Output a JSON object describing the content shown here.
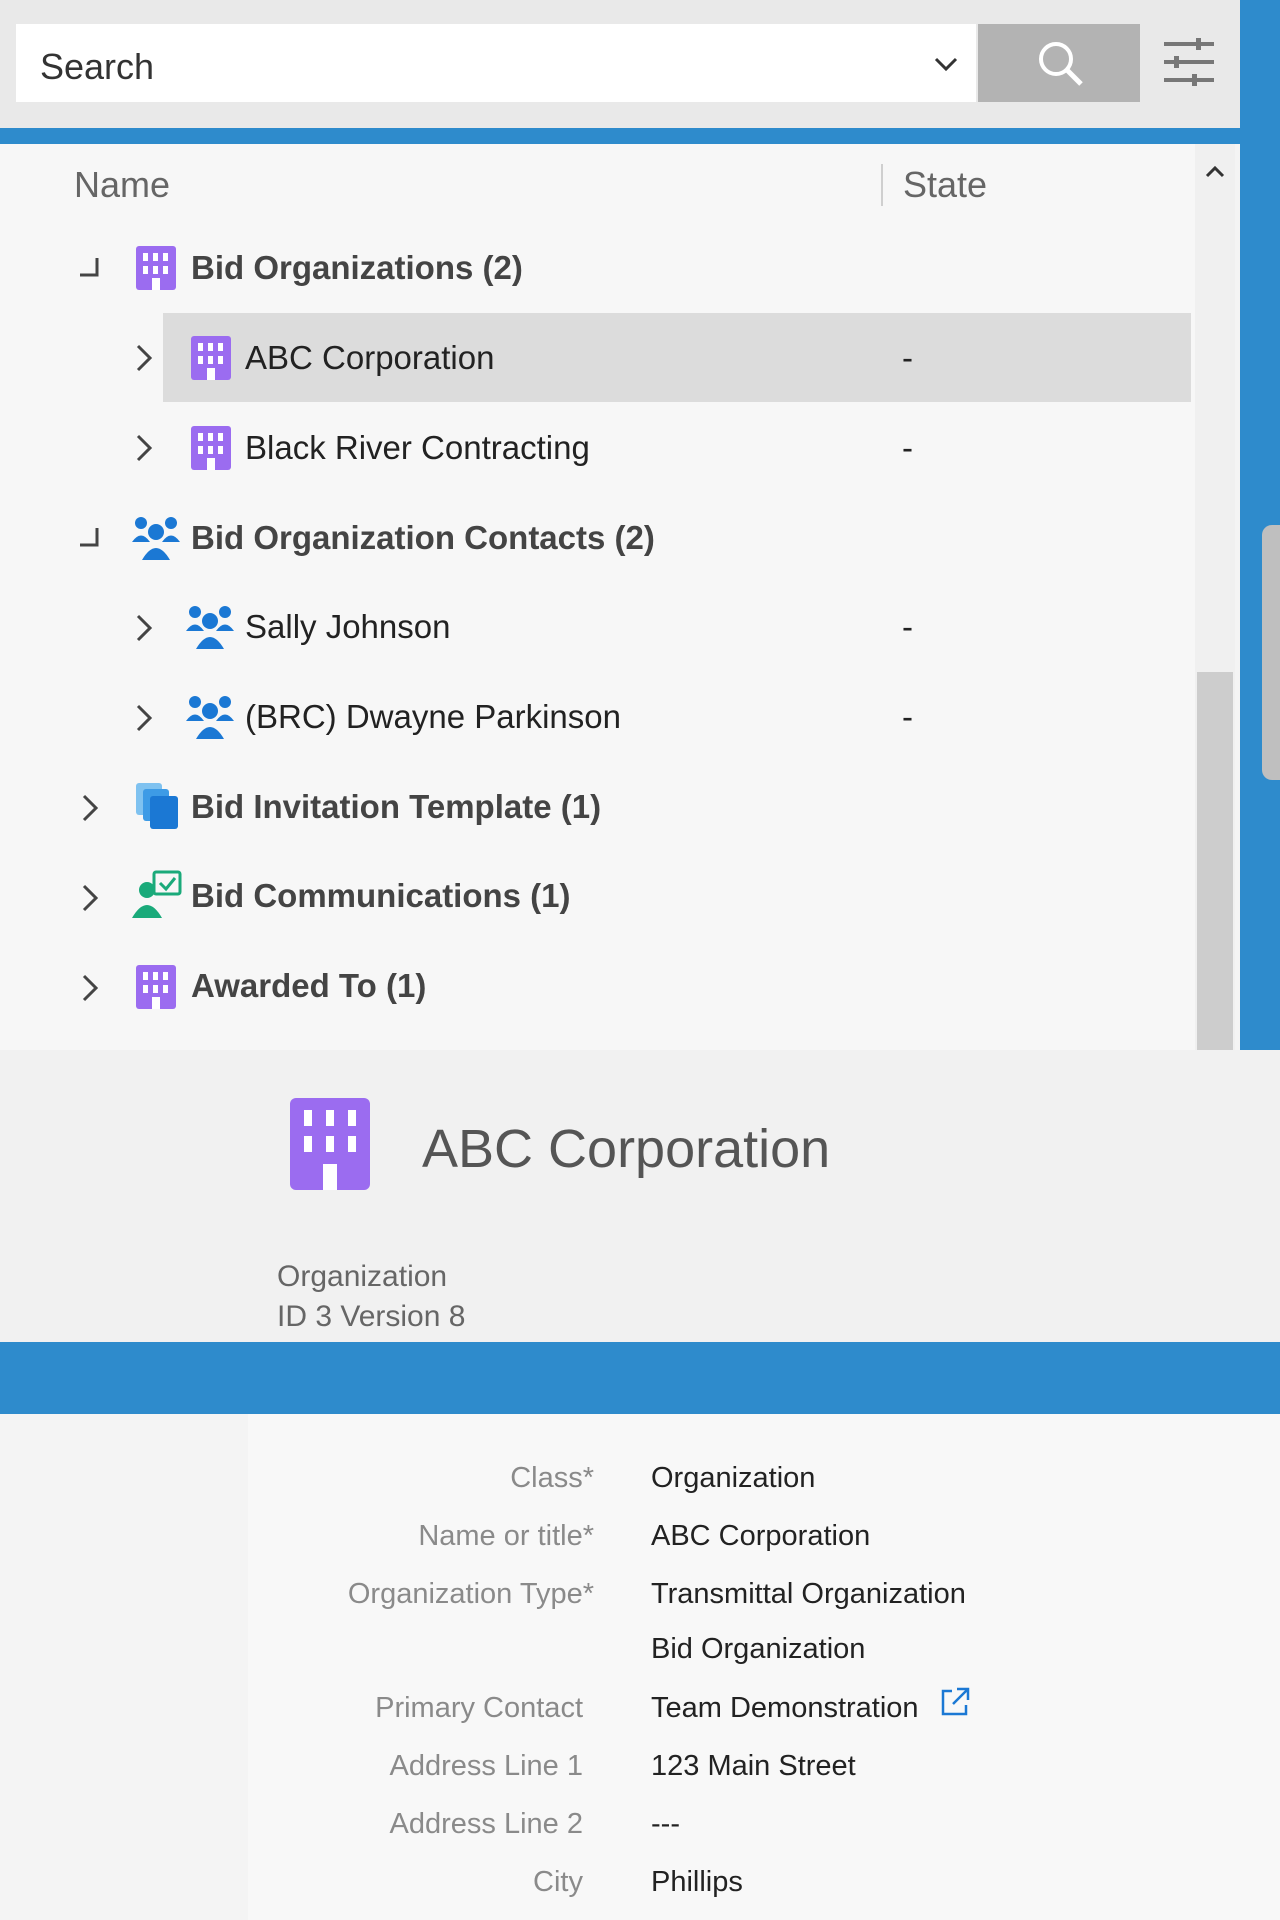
{
  "search": {
    "placeholder": "Search"
  },
  "tree": {
    "columns": {
      "name": "Name",
      "state": "State"
    },
    "items": [
      {
        "label": "Bid Organizations (2)",
        "state": ""
      },
      {
        "label": "ABC Corporation",
        "state": "-"
      },
      {
        "label": "Black River Contracting",
        "state": "-"
      },
      {
        "label": "Bid Organization Contacts (2)",
        "state": ""
      },
      {
        "label": "Sally Johnson",
        "state": "-"
      },
      {
        "label": "(BRC) Dwayne Parkinson",
        "state": "-"
      },
      {
        "label": "Bid Invitation Template (1)",
        "state": ""
      },
      {
        "label": "Bid Communications (1)",
        "state": ""
      },
      {
        "label": "Awarded To (1)",
        "state": ""
      }
    ]
  },
  "detail": {
    "title": "ABC Corporation",
    "class_label": "Organization",
    "meta": "ID 3  Version 8",
    "fields": [
      {
        "label": "Class*",
        "value": "Organization"
      },
      {
        "label": "Name or title*",
        "value": "ABC Corporation"
      },
      {
        "label": "Organization Type*",
        "value": "Transmittal Organization"
      },
      {
        "label": "",
        "value": "Bid Organization"
      },
      {
        "label": "Primary Contact",
        "value": "Team Demonstration"
      },
      {
        "label": "Address Line 1",
        "value": "123 Main Street"
      },
      {
        "label": "Address Line 2",
        "value": "---"
      },
      {
        "label": "City",
        "value": "Phillips"
      }
    ]
  },
  "colors": {
    "accent_blue": "#2e8bcc",
    "org_icon": "#9b6cf0",
    "contact_icon": "#1b78d4",
    "comm_icon": "#1aaa7a",
    "selected_row": "#dcdcdc"
  }
}
